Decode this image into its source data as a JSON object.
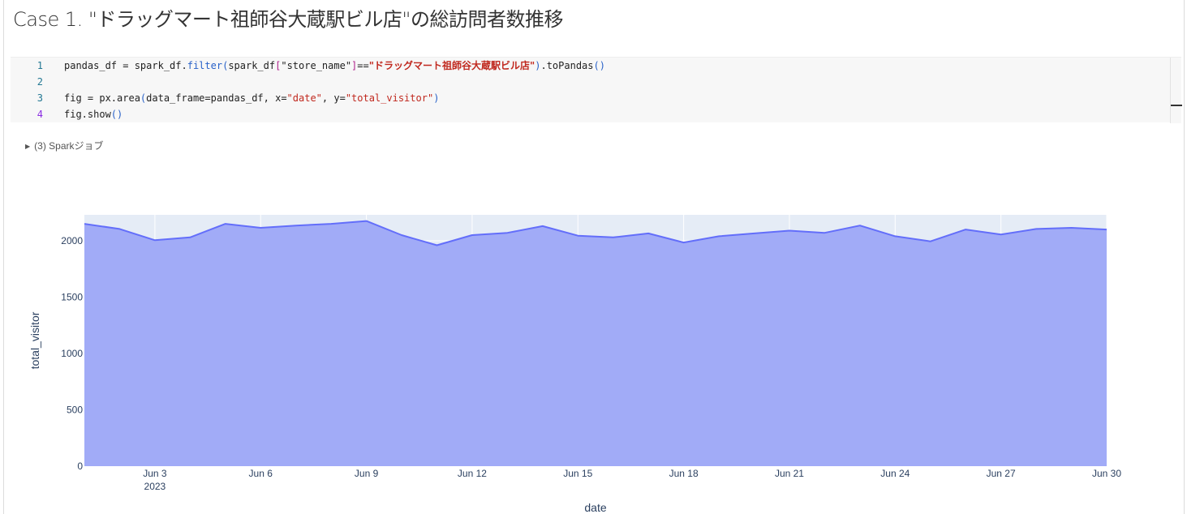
{
  "cell": {
    "title": "Case 1. \"ドラッグマート祖師谷大蔵駅ビル店\"の総訪問者数推移"
  },
  "code": {
    "lines": [
      {
        "no": "1",
        "segments": [
          {
            "t": "pandas_df = spark_df.",
            "c": ""
          },
          {
            "t": "filter",
            "c": "t-fn"
          },
          {
            "t": "(",
            "c": "t-br2"
          },
          {
            "t": "spark_df",
            "c": ""
          },
          {
            "t": "[",
            "c": "t-br"
          },
          {
            "t": "\"store_name\"",
            "c": ""
          },
          {
            "t": "]",
            "c": "t-br"
          },
          {
            "t": "==",
            "c": ""
          },
          {
            "t": "\"ドラッグマート祖師谷大蔵駅ビル店\"",
            "c": "t-strj"
          },
          {
            "t": ")",
            "c": "t-br2"
          },
          {
            "t": ".toPandas",
            "c": ""
          },
          {
            "t": "()",
            "c": "t-br2"
          }
        ]
      },
      {
        "no": "2",
        "segments": []
      },
      {
        "no": "3",
        "segments": [
          {
            "t": "fig = px.area",
            "c": ""
          },
          {
            "t": "(",
            "c": "t-br2"
          },
          {
            "t": "data_frame=pandas_df, x=",
            "c": ""
          },
          {
            "t": "\"date\"",
            "c": "t-str"
          },
          {
            "t": ", y=",
            "c": ""
          },
          {
            "t": "\"total_visitor\"",
            "c": "t-str"
          },
          {
            "t": ")",
            "c": "t-br2"
          }
        ]
      },
      {
        "no": "4",
        "segments": [
          {
            "t": "fig.show",
            "c": ""
          },
          {
            "t": "()",
            "c": "t-br2"
          }
        ]
      }
    ]
  },
  "spark_jobs": {
    "label": "(3) Sparkジョブ"
  },
  "colors": {
    "plot_bg": "#e5ecf6",
    "area_fill": "#a1abf7",
    "line": "#636efa",
    "grid": "#ffffff"
  },
  "chart_data": {
    "type": "area",
    "xlabel": "date",
    "ylabel": "total_visitor",
    "xlim": [
      "2023-06-01",
      "2023-06-30"
    ],
    "ylim": [
      0,
      2230
    ],
    "y_ticks": [
      0,
      500,
      1000,
      1500,
      2000
    ],
    "x_ticks": [
      {
        "date": "2023-06-03",
        "label": "Jun 3",
        "sublabel": "2023"
      },
      {
        "date": "2023-06-06",
        "label": "Jun 6"
      },
      {
        "date": "2023-06-09",
        "label": "Jun 9"
      },
      {
        "date": "2023-06-12",
        "label": "Jun 12"
      },
      {
        "date": "2023-06-15",
        "label": "Jun 15"
      },
      {
        "date": "2023-06-18",
        "label": "Jun 18"
      },
      {
        "date": "2023-06-21",
        "label": "Jun 21"
      },
      {
        "date": "2023-06-24",
        "label": "Jun 24"
      },
      {
        "date": "2023-06-27",
        "label": "Jun 27"
      },
      {
        "date": "2023-06-30",
        "label": "Jun 30"
      }
    ],
    "grid": true,
    "legend": "none",
    "x": [
      "2023-06-01",
      "2023-06-02",
      "2023-06-03",
      "2023-06-04",
      "2023-06-05",
      "2023-06-06",
      "2023-06-07",
      "2023-06-08",
      "2023-06-09",
      "2023-06-10",
      "2023-06-11",
      "2023-06-12",
      "2023-06-13",
      "2023-06-14",
      "2023-06-15",
      "2023-06-16",
      "2023-06-17",
      "2023-06-18",
      "2023-06-19",
      "2023-06-20",
      "2023-06-21",
      "2023-06-22",
      "2023-06-23",
      "2023-06-24",
      "2023-06-25",
      "2023-06-26",
      "2023-06-27",
      "2023-06-28",
      "2023-06-29",
      "2023-06-30"
    ],
    "values": [
      2150,
      2105,
      2005,
      2030,
      2150,
      2115,
      2135,
      2150,
      2175,
      2050,
      1960,
      2050,
      2070,
      2130,
      2045,
      2030,
      2065,
      1985,
      2040,
      2065,
      2090,
      2070,
      2135,
      2040,
      1995,
      2100,
      2055,
      2105,
      2115,
      2100
    ]
  }
}
